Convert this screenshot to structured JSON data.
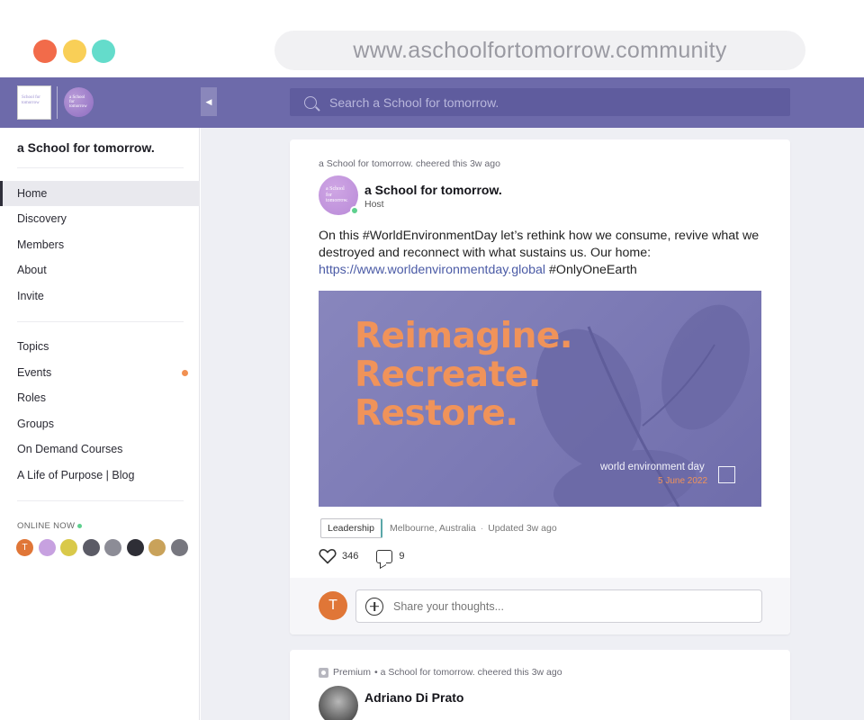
{
  "browser": {
    "url": "www.aschoolfortomorrow.community"
  },
  "header": {
    "logo_text": "School for tomorrow",
    "logo_circle_text": "a School for tomorrow",
    "collapse_glyph": "◀",
    "search_placeholder": "Search a School for tomorrow."
  },
  "sidebar": {
    "community_name": "a School for tomorrow.",
    "primary_items": [
      {
        "label": "Home",
        "active": true
      },
      {
        "label": "Discovery"
      },
      {
        "label": "Members"
      },
      {
        "label": "About"
      },
      {
        "label": "Invite"
      }
    ],
    "secondary_items": [
      {
        "label": "Topics"
      },
      {
        "label": "Events",
        "has_badge": true
      },
      {
        "label": "Roles"
      },
      {
        "label": "Groups"
      },
      {
        "label": "On Demand Courses"
      },
      {
        "label": "A Life of Purpose | Blog"
      }
    ],
    "online_now_label": "ONLINE NOW",
    "online_avatars": [
      {
        "initial": "T",
        "color": "#e07637"
      },
      {
        "initial": "",
        "color": "#c7a1e0"
      },
      {
        "initial": "",
        "color": "#d9c94a"
      },
      {
        "initial": "",
        "color": "#5b5b66"
      },
      {
        "initial": "",
        "color": "#8c8c96"
      },
      {
        "initial": "",
        "color": "#2e2e36"
      },
      {
        "initial": "",
        "color": "#c9a25a"
      },
      {
        "initial": "",
        "color": "#77777f"
      }
    ]
  },
  "feed": {
    "posts": [
      {
        "activity": "a School for tomorrow. cheered this 3w ago",
        "author": "a School for tomorrow.",
        "author_avatar_text": "a School for tomorrow.",
        "role": "Host",
        "body_before_link": "On this #WorldEnvironmentDay let’s rethink how we consume, revive what we destroyed and reconnect with what sustains us. Our home: ",
        "link": "https://www.worldenvironmentday.global",
        "body_after_link": " #OnlyOneEarth",
        "image": {
          "headline_1": "Reimagine.",
          "headline_2": "Recreate.",
          "headline_3": "Restore.",
          "event_name": "world environment day",
          "event_date": "5 June 2022"
        },
        "tag": "Leadership",
        "location": "Melbourne, Australia",
        "separator": "·",
        "updated": "Updated 3w ago",
        "likes": "346",
        "comments": "9",
        "comment_placeholder": "Share your thoughts...",
        "my_initial": "T"
      },
      {
        "premium_label": "Premium",
        "activity": "• a School for tomorrow. cheered this 3w ago",
        "author": "Adriano Di Prato"
      }
    ]
  },
  "colors": {
    "accent": "#6d6aaa",
    "orange": "#f0935a",
    "online": "#5ed08e"
  }
}
